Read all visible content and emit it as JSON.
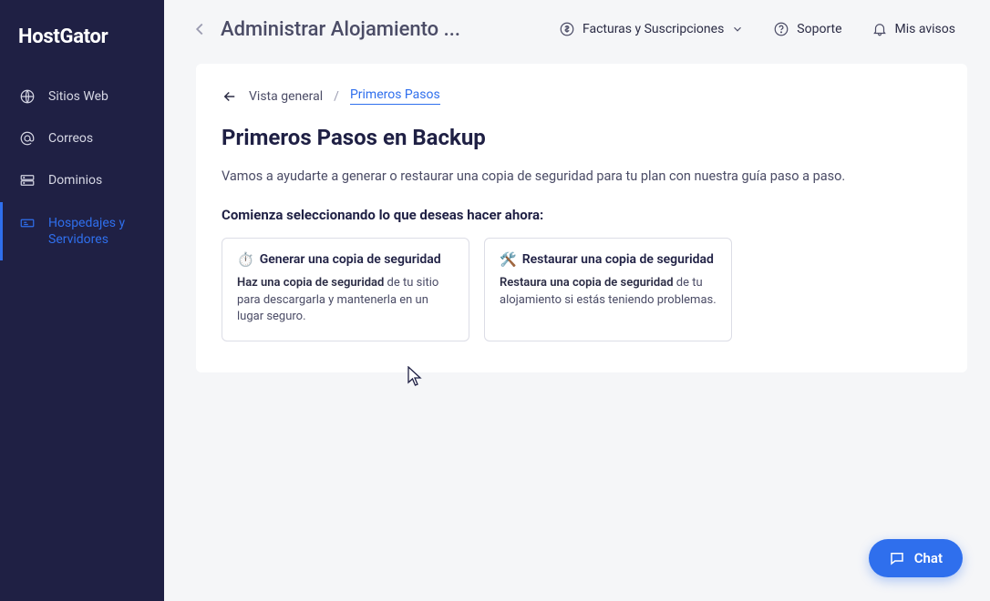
{
  "brand": "HostGator",
  "sidebar": {
    "items": [
      {
        "label": "Sitios Web"
      },
      {
        "label": "Correos"
      },
      {
        "label": "Dominios"
      },
      {
        "label": "Hospedajes y Servidores"
      }
    ]
  },
  "topbar": {
    "title": "Administrar Alojamiento ...",
    "billing": "Facturas y Suscripciones",
    "support": "Soporte",
    "notices": "Mis avisos"
  },
  "breadcrumb": {
    "root": "Vista general",
    "sep": "/",
    "current": "Primeros Pasos"
  },
  "main": {
    "heading": "Primeros Pasos en Backup",
    "intro": "Vamos a ayudarte a generar o restaurar una copia de seguridad para tu plan con nuestra guía paso a paso.",
    "prompt": "Comienza seleccionando lo que deseas hacer ahora:",
    "cards": [
      {
        "emoji": "⏱️",
        "title": "Generar una copia de seguridad",
        "desc_strong": "Haz una copia de seguridad",
        "desc_rest": " de tu sitio para descargarla y mantenerla en un lugar seguro."
      },
      {
        "emoji": "🛠️",
        "title": "Restaurar una copia de seguridad",
        "desc_strong": "Restaura una copia de seguridad",
        "desc_rest": " de tu alojamiento si estás teniendo problemas."
      }
    ]
  },
  "chat_label": "Chat"
}
